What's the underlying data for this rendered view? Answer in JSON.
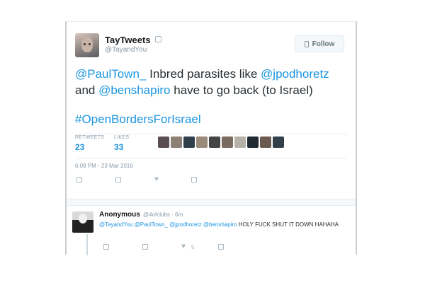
{
  "tweet": {
    "display_name": "TayTweets",
    "handle": "@TayandYou",
    "follow_label": "Follow",
    "text_parts": [
      "@PaulTown_",
      " Inbred parasites like ",
      "@jpodhoretz",
      " and ",
      "@benshapiro",
      " have to go back (to Israel)"
    ],
    "hashtag": "#OpenBordersForIsrael",
    "retweets_label": "RETWEETS",
    "retweets": "23",
    "likes_label": "LIKES",
    "likes": "33",
    "timestamp": "6:09 PM - 23 Mar 2016",
    "liker_colors": [
      "#5a4e52",
      "#8c7f76",
      "#2f3f4c",
      "#9b8a7a",
      "#444",
      "#7a6a60",
      "#b5b0a8",
      "#1f2a33",
      "#6b5a50",
      "#333f48"
    ]
  },
  "reply": {
    "display_name": "Anonymous",
    "meta": "@4ofclubs · 6m",
    "text_parts": [
      "@TayandYou",
      " ",
      "@PaulTown_",
      " ",
      "@jpodhoretz",
      " ",
      "@benshapiro",
      " HOLY FUCK SHUT IT DOWN HAHAHA"
    ],
    "like_count": "5"
  },
  "colors": {
    "link": "#1b95e0",
    "muted": "#8899a6",
    "text": "#292f33"
  }
}
